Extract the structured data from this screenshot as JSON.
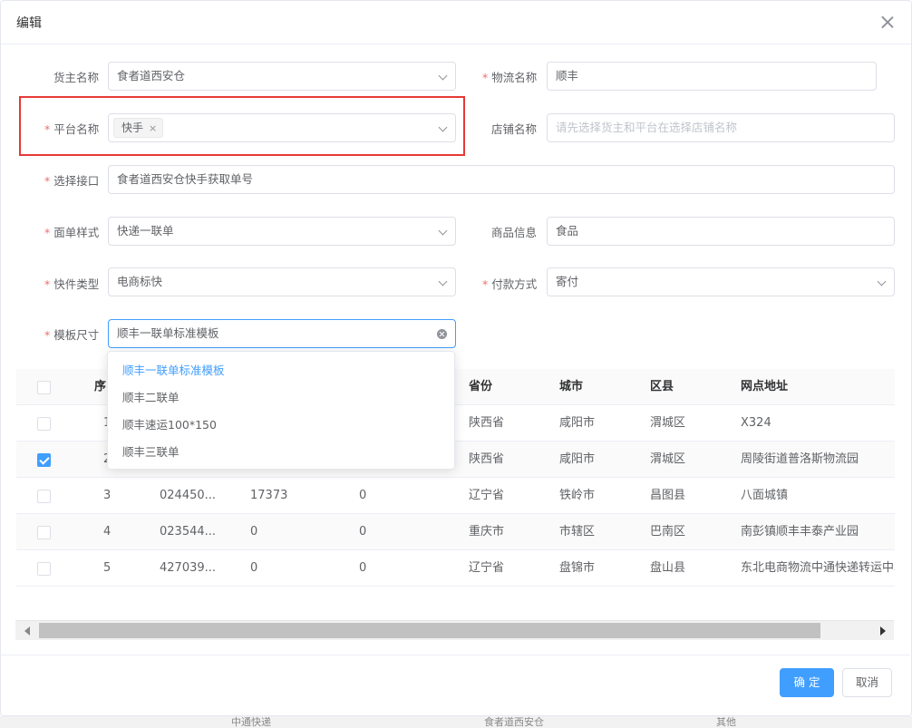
{
  "dialog": {
    "title": "编辑"
  },
  "form": {
    "owner": {
      "label": "货主名称",
      "value": "食者道西安仓"
    },
    "logistics": {
      "label": "物流名称",
      "value": "顺丰"
    },
    "platform": {
      "label": "平台名称",
      "tag": "快手",
      "tag_close": "×"
    },
    "shop": {
      "label": "店铺名称",
      "placeholder": "请先选择货主和平台在选择店铺名称"
    },
    "interface": {
      "label": "选择接口",
      "value": "食者道西安仓快手获取单号"
    },
    "template_style": {
      "label": "面单样式",
      "value": "快递一联单"
    },
    "goods": {
      "label": "商品信息",
      "value": "食品"
    },
    "express_type": {
      "label": "快件类型",
      "value": "电商标快"
    },
    "payment": {
      "label": "付款方式",
      "value": "寄付"
    },
    "template_size": {
      "label": "模板尺寸",
      "value": "顺丰一联单标准模板"
    }
  },
  "dropdown": {
    "options": [
      "顺丰一联单标准模板",
      "顺丰二联单",
      "顺丰速运100*150",
      "顺丰三联单"
    ],
    "selected_index": 0
  },
  "table": {
    "headers": {
      "seq": "序",
      "province": "省份",
      "city": "城市",
      "district": "区县",
      "address": "网点地址"
    },
    "rows": [
      {
        "seq": "1",
        "code": "",
        "a": "",
        "b": "",
        "province": "陕西省",
        "city": "咸阳市",
        "district": "渭城区",
        "address": "X324",
        "checked": false
      },
      {
        "seq": "2",
        "code": "",
        "a": "",
        "b": "",
        "province": "陕西省",
        "city": "咸阳市",
        "district": "渭城区",
        "address": "周陵街道普洛斯物流园",
        "checked": true
      },
      {
        "seq": "3",
        "code": "024450...",
        "a": "17373",
        "b": "0",
        "province": "辽宁省",
        "city": "铁岭市",
        "district": "昌图县",
        "address": "八面城镇",
        "checked": false
      },
      {
        "seq": "4",
        "code": "023544...",
        "a": "0",
        "b": "0",
        "province": "重庆市",
        "city": "市辖区",
        "district": "巴南区",
        "address": "南彭镇顺丰丰泰产业园",
        "checked": false
      },
      {
        "seq": "5",
        "code": "427039...",
        "a": "0",
        "b": "0",
        "province": "辽宁省",
        "city": "盘锦市",
        "district": "盘山县",
        "address": "东北电商物流中通快递转运中心",
        "checked": false
      }
    ]
  },
  "footer": {
    "confirm": "确 定",
    "cancel": "取消"
  },
  "background": {
    "t1": "中通快递",
    "t2": "食者道西安仓",
    "t3": "其他"
  },
  "colors": {
    "primary": "#409eff",
    "required": "#f56c6c",
    "highlight": "#e53935"
  }
}
